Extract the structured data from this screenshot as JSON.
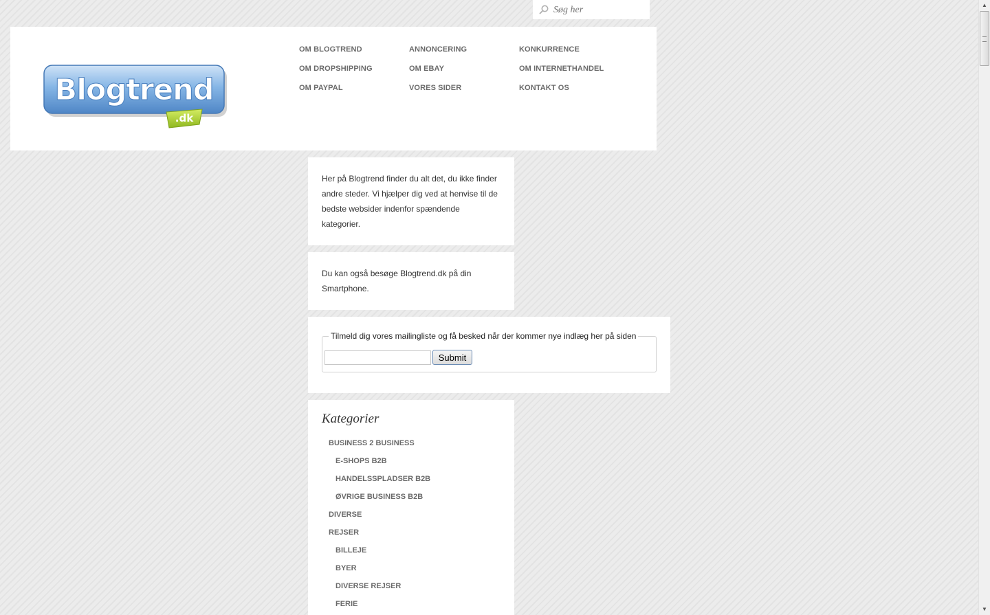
{
  "search": {
    "placeholder": "Søg her"
  },
  "logo": {
    "main": "Blogtrend",
    "sub": ".dk"
  },
  "nav": {
    "items": [
      {
        "label": "OM BLOGTREND"
      },
      {
        "label": "ANNONCERING"
      },
      {
        "label": "KONKURRENCE"
      },
      {
        "label": "OM DROPSHIPPING"
      },
      {
        "label": "OM EBAY"
      },
      {
        "label": "OM INTERNETHANDEL"
      },
      {
        "label": "OM PAYPAL"
      },
      {
        "label": "VORES SIDER"
      },
      {
        "label": "KONTAKT OS"
      }
    ]
  },
  "intro": {
    "text": "Her på Blogtrend finder du alt det, du ikke finder andre steder. Vi hjælper dig ved at henvise til de bedste websider indenfor spændende kategorier."
  },
  "mobile": {
    "text": "Du kan også besøge Blogtrend.dk på din Smartphone."
  },
  "newsletter": {
    "legend": "Tilmeld dig vores mailingliste og få besked når der kommer nye indlæg her på siden",
    "email_value": "",
    "submit_label": "Submit"
  },
  "categories": {
    "title": "Kategorier",
    "items": [
      {
        "label": "BUSINESS 2 BUSINESS"
      },
      {
        "label": "E-SHOPS B2B"
      },
      {
        "label": "HANDELSSPLADSER B2B"
      },
      {
        "label": "ØVRIGE BUSINESS B2B"
      },
      {
        "label": "DIVERSE"
      },
      {
        "label": "REJSER"
      },
      {
        "label": "BILLEJE"
      },
      {
        "label": "BYER"
      },
      {
        "label": "DIVERSE REJSER"
      },
      {
        "label": "FERIE"
      }
    ]
  },
  "colors": {
    "link": "#6a6a6a",
    "logo_blue": "#5b93cf",
    "logo_green": "#a6c92a",
    "background": "#e9e9e9"
  }
}
